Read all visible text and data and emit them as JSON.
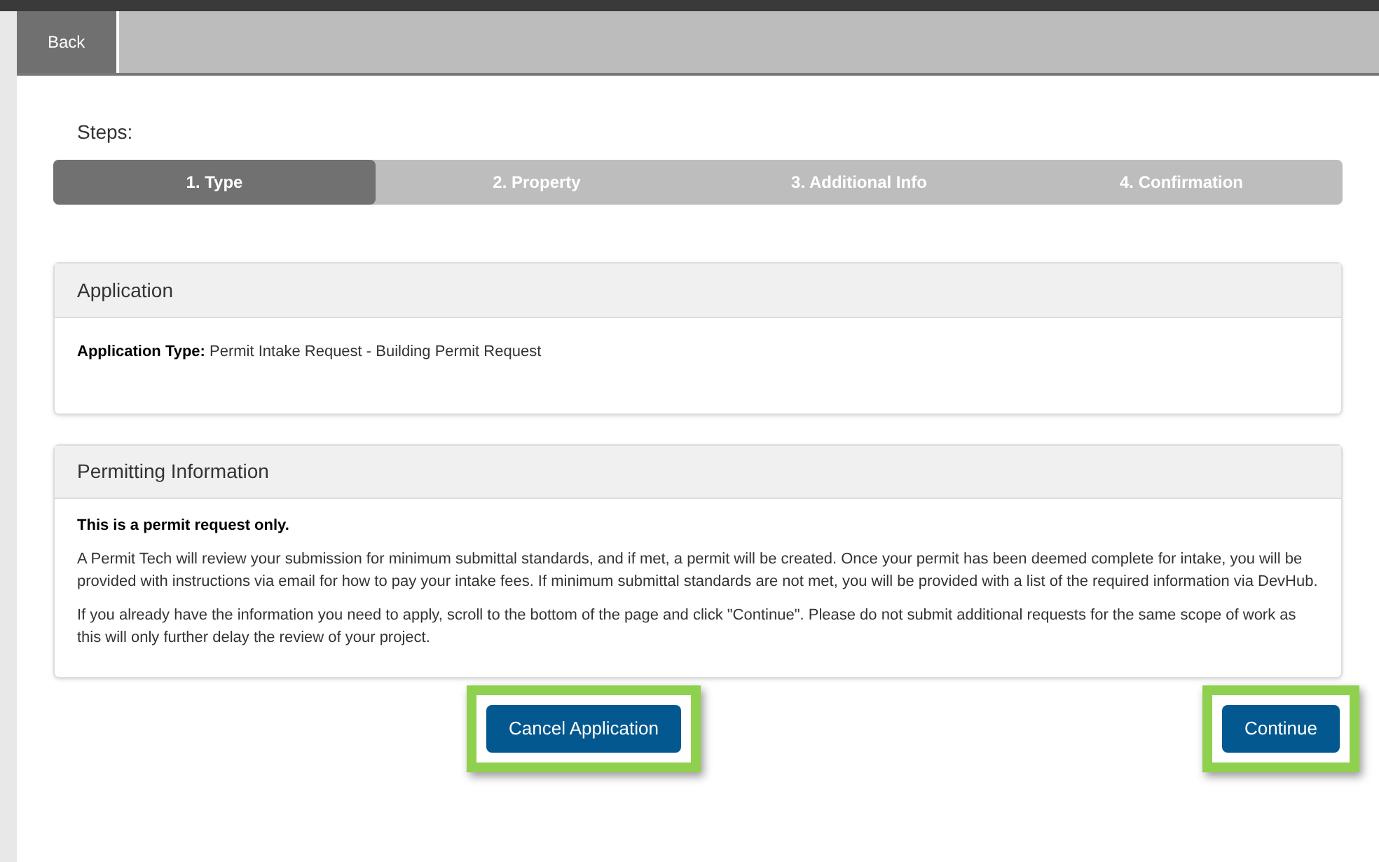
{
  "toolbar": {
    "back_button": "Back"
  },
  "steps": {
    "label": "Steps:",
    "items": [
      {
        "label": "1. Type",
        "selected": true
      },
      {
        "label": "2. Property",
        "selected": false
      },
      {
        "label": "3. Additional Info",
        "selected": false
      },
      {
        "label": "4. Confirmation",
        "selected": false
      }
    ]
  },
  "application_panel": {
    "title": "Application",
    "field_label": "Application Type:",
    "field_value": "Permit Intake Request - Building Permit Request"
  },
  "permitting_panel": {
    "title": "Permitting Information",
    "lead": "This is a permit request only.",
    "paragraphs": [
      "A Permit Tech will review your submission for minimum submittal standards, and if met, a permit will be created. Once your permit has been deemed complete for intake, you will be provided with instructions via email for how to pay your intake fees. If minimum submittal standards are not met, you will be provided with a list of the required information via DevHub.",
      "If you already have the information you need to apply, scroll to the bottom of the page and click \"Continue\". Please do not submit additional requests for the same scope of work as this will only further delay the review of your project."
    ]
  },
  "actions": [
    {
      "label": "Cancel Application",
      "highlighted": true
    },
    {
      "label": "Continue",
      "highlighted": true
    }
  ]
}
